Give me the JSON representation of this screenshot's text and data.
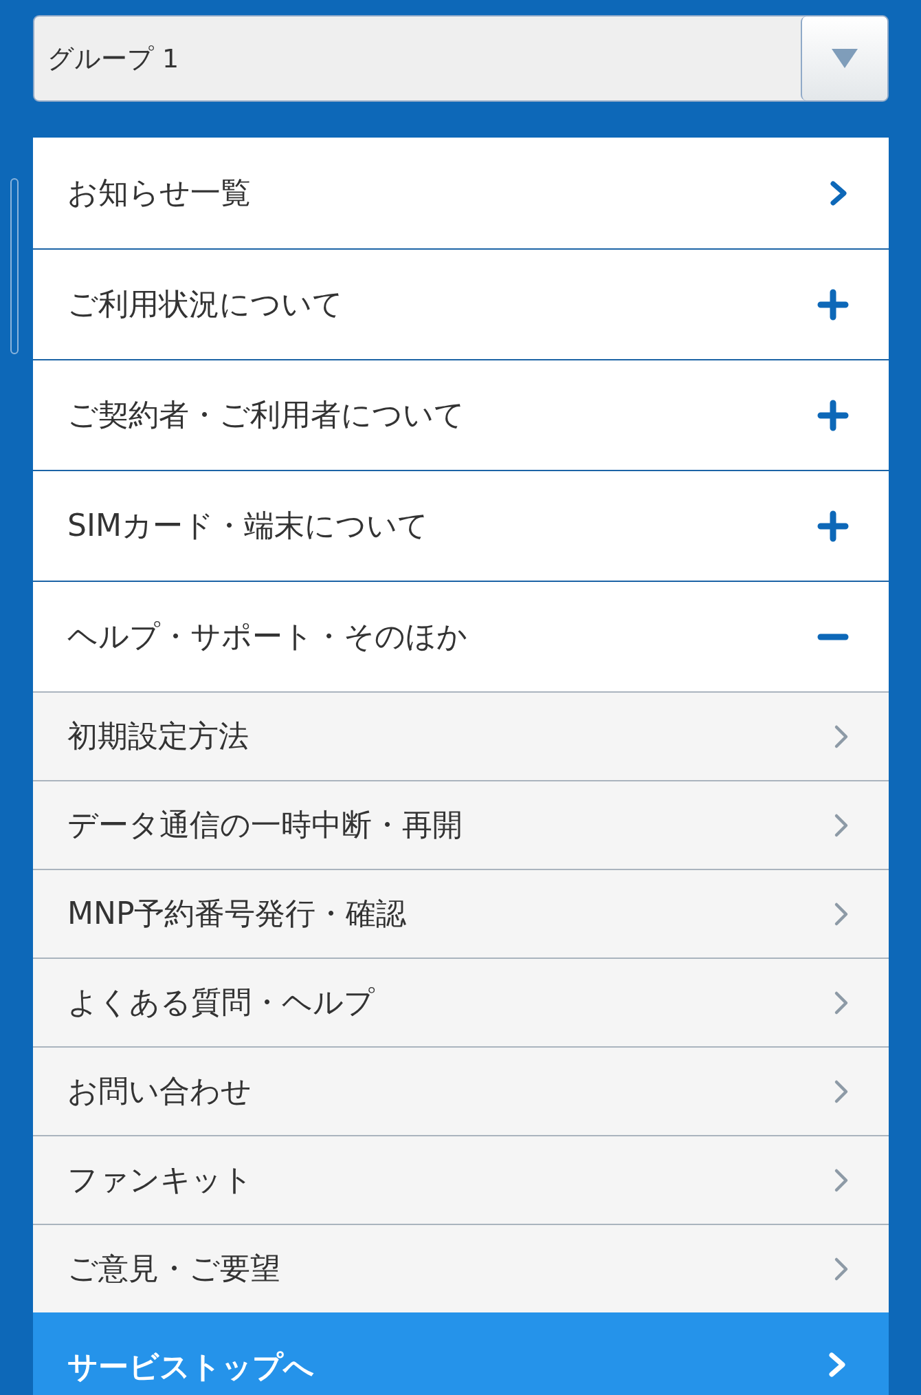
{
  "group_select": {
    "value": "グループ 1"
  },
  "menu": [
    {
      "kind": "link",
      "label": "お知らせ一覧"
    },
    {
      "kind": "section",
      "label": "ご利用状況について",
      "expanded": false
    },
    {
      "kind": "section",
      "label": "ご契約者・ご利用者について",
      "expanded": false
    },
    {
      "kind": "section",
      "label": "SIMカード・端末について",
      "expanded": false
    },
    {
      "kind": "section",
      "label": "ヘルプ・サポート・そのほか",
      "expanded": true,
      "children": [
        {
          "label": "初期設定方法"
        },
        {
          "label": "データ通信の一時中断・再開"
        },
        {
          "label": "MNP予約番号発行・確認"
        },
        {
          "label": "よくある質問・ヘルプ"
        },
        {
          "label": "お問い合わせ"
        },
        {
          "label": "ファンキット"
        },
        {
          "label": "ご意見・ご要望"
        }
      ]
    }
  ],
  "service_top_button": {
    "label": "サービストップへ"
  }
}
